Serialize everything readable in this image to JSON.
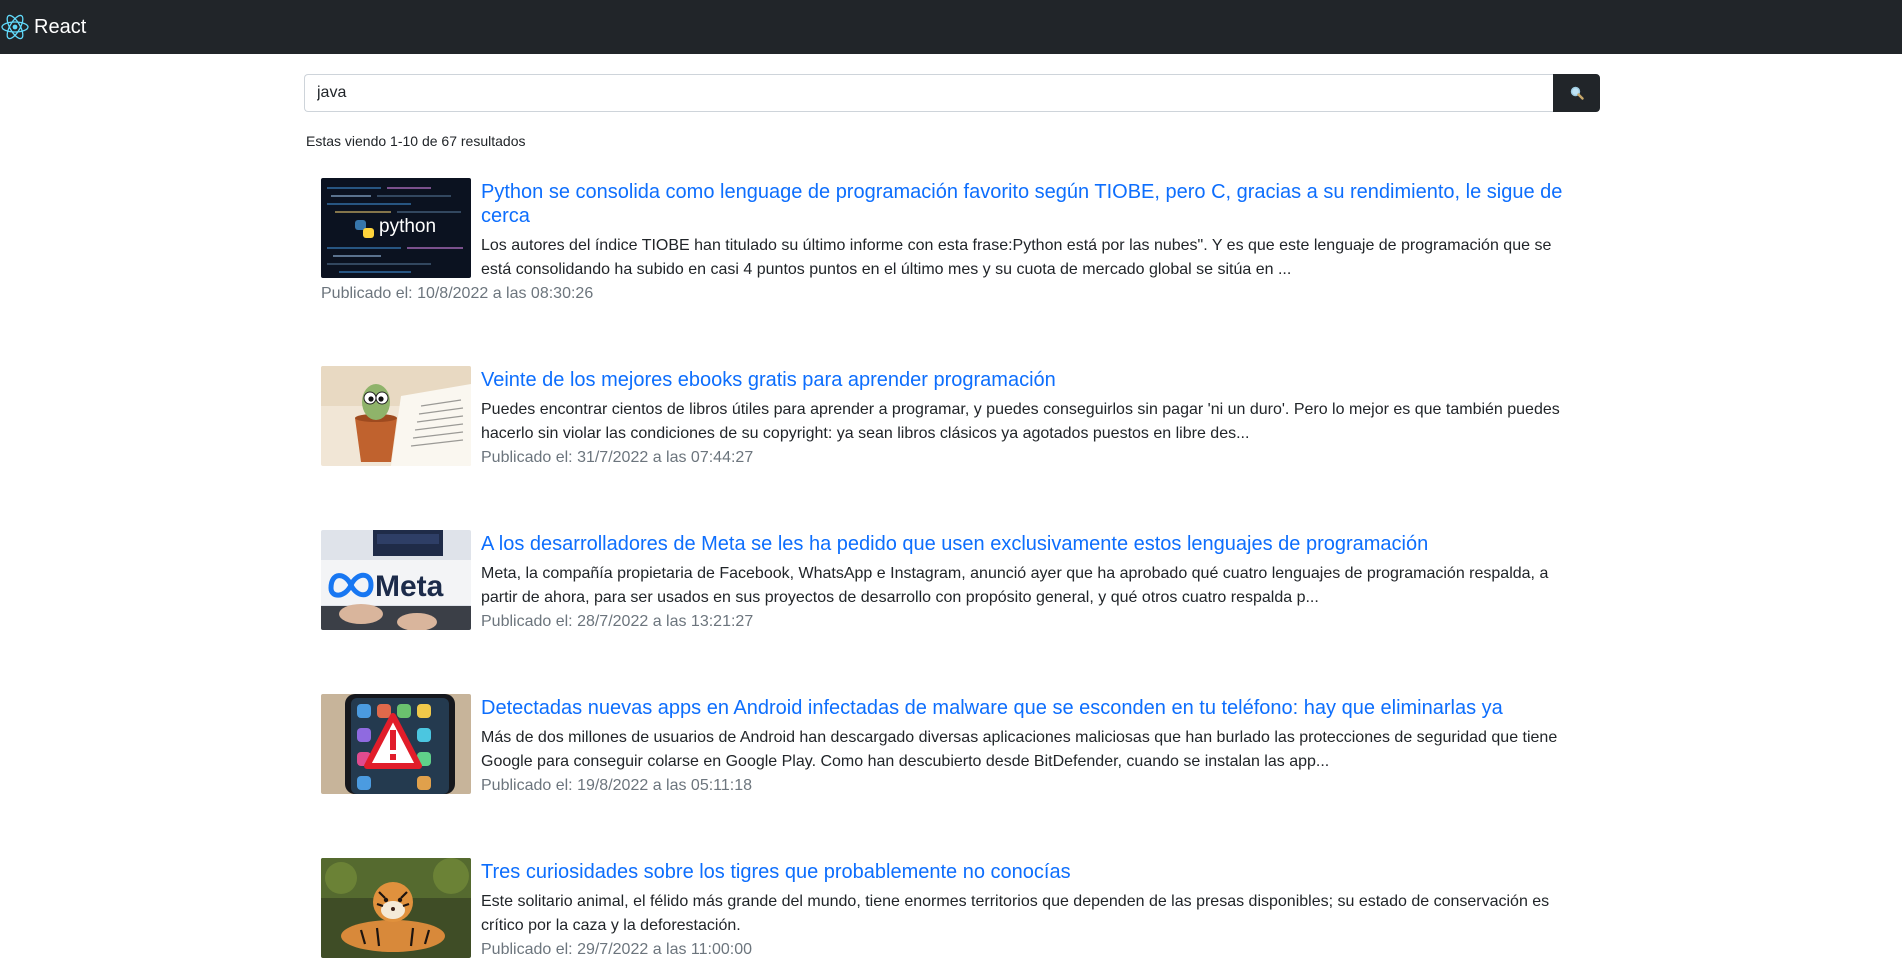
{
  "navbar": {
    "brand": "React"
  },
  "search": {
    "value": "java",
    "icon": "search-icon"
  },
  "results_summary": "Estas viendo 1-10 de 67 resultados",
  "results": [
    {
      "title": "Python se consolida como lenguage de programación favorito según TIOBE, pero C, gracias a su rendimiento, le sigue de cerca",
      "snippet": "Los autores del índice TIOBE han titulado su último informe con esta frase:Python está por las nubes\". Y es que este lenguaje de programación que se está consolidando ha subido en casi 4 puntos puntos en el último mes y su cuota de mercado global se sitúa en ...",
      "date": "Publicado el: 10/8/2022 a las 08:30:26",
      "thumb_text": "python"
    },
    {
      "title": "Veinte de los mejores ebooks gratis para aprender programación",
      "snippet": "Puedes encontrar cientos de libros útiles para aprender a programar, y puedes conseguirlos sin pagar 'ni un duro'. Pero lo mejor es que también puedes hacerlo sin violar las condiciones de su copyright: ya sean libros clásicos ya agotados puestos en libre des...",
      "date": "Publicado el: 31/7/2022 a las 07:44:27",
      "thumb_text": ""
    },
    {
      "title": "A los desarrolladores de Meta se les ha pedido que usen exclusivamente estos lenguajes de programación",
      "snippet": "Meta, la compañía propietaria de Facebook, WhatsApp e Instagram, anunció ayer que ha aprobado qué cuatro lenguajes de programación respalda, a partir de ahora, para ser usados en sus proyectos de desarrollo con propósito general, y qué otros cuatro respalda p...",
      "date": "Publicado el: 28/7/2022 a las 13:21:27",
      "thumb_text": "Meta"
    },
    {
      "title": "Detectadas nuevas apps en Android infectadas de malware que se esconden en tu teléfono: hay que eliminarlas ya",
      "snippet": "Más de dos millones de usuarios de Android han descargado diversas aplicaciones maliciosas que han burlado las protecciones de seguridad que tiene Google para conseguir colarse en Google Play. Como han descubierto desde BitDefender, cuando se instalan las app...",
      "date": "Publicado el: 19/8/2022 a las 05:11:18",
      "thumb_text": ""
    },
    {
      "title": "Tres curiosidades sobre los tigres que probablemente no conocías",
      "snippet": "Este solitario animal, el félido más grande del mundo, tiene enormes territorios que dependen de las presas disponibles; su estado de conservación es crítico por la caza y la deforestación.",
      "date": "Publicado el: 29/7/2022 a las 11:00:00",
      "thumb_text": ""
    }
  ]
}
